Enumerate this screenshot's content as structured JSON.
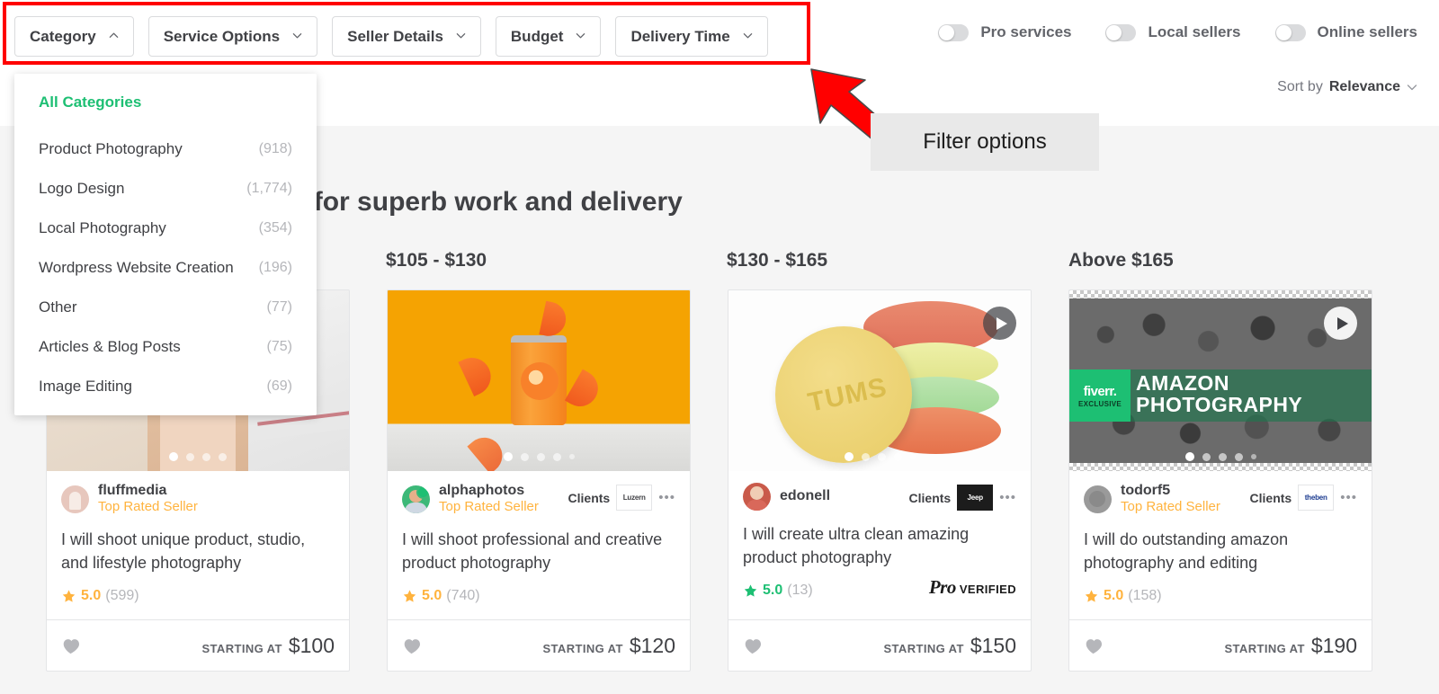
{
  "filter_bar": {
    "pills": [
      {
        "label": "Category",
        "icon": "chevron-up-icon",
        "expanded": true
      },
      {
        "label": "Service Options",
        "icon": "chevron-down-icon",
        "expanded": false
      },
      {
        "label": "Seller Details",
        "icon": "chevron-down-icon",
        "expanded": false
      },
      {
        "label": "Budget",
        "icon": "chevron-down-icon",
        "expanded": false
      },
      {
        "label": "Delivery Time",
        "icon": "chevron-down-icon",
        "expanded": false
      }
    ],
    "toggles": [
      {
        "label": "Pro services",
        "on": false
      },
      {
        "label": "Local sellers",
        "on": false
      },
      {
        "label": "Online sellers",
        "on": false
      }
    ],
    "sort": {
      "prefix": "Sort by",
      "value": "Relevance",
      "icon": "chevron-down-icon"
    }
  },
  "annotation": {
    "callout_label": "Filter options",
    "box_color": "#ff0000",
    "arrow_color": "#ff0000",
    "callout_bg": "#e9e9e9"
  },
  "category_dropdown": {
    "all_label": "All Categories",
    "items": [
      {
        "name": "Product Photography",
        "count": "(918)"
      },
      {
        "name": "Logo Design",
        "count": "(1,774)"
      },
      {
        "name": "Local Photography",
        "count": "(354)"
      },
      {
        "name": "Wordpress Website Creation",
        "count": "(196)"
      },
      {
        "name": "Other",
        "count": "(77)"
      },
      {
        "name": "Articles & Blog Posts",
        "count": "(75)"
      },
      {
        "name": "Image Editing",
        "count": "(69)"
      }
    ]
  },
  "headline": "es that people loved for superb work and delivery",
  "price_columns": [
    {
      "label": "$105 - $130"
    },
    {
      "label": "$130 - $165"
    },
    {
      "label": "Above $165"
    }
  ],
  "cards": [
    {
      "seller": "fluffmedia",
      "level": "Top Rated Seller",
      "title": "I will shoot unique product, studio, and lifestyle photography",
      "rating": "5.0",
      "reviews": "(599)",
      "starting_at": "STARTING AT",
      "price": "$100",
      "has_video": false,
      "clients": null,
      "pro_verified": false,
      "thumb": "collage-cosmetics",
      "dots": 4,
      "active_dot": 0
    },
    {
      "seller": "alphaphotos",
      "level": "Top Rated Seller",
      "title": "I will shoot professional and creative product photography",
      "rating": "5.0",
      "reviews": "(740)",
      "starting_at": "STARTING AT",
      "price": "$120",
      "has_video": false,
      "clients": {
        "label": "Clients",
        "logo": "Luzern",
        "menu": "•••"
      },
      "pro_verified": false,
      "thumb": "orange-soda-can",
      "dots": 5,
      "active_dot": 0
    },
    {
      "seller": "edonell",
      "level": "",
      "title": "I will create ultra clean amazing product photography",
      "rating": "5.0",
      "reviews": "(13)",
      "starting_at": "STARTING AT",
      "price": "$150",
      "has_video": true,
      "clients": {
        "label": "Clients",
        "logo": "Jeep",
        "menu": "•••"
      },
      "pro_verified": true,
      "pro_text": "Pro",
      "verified_text": "VERIFIED",
      "thumb": "tums-tablets",
      "dots": 5,
      "active_dot": 0
    },
    {
      "seller": "todorf5",
      "level": "Top Rated Seller",
      "title": "I will do outstanding amazon photography and editing",
      "rating": "5.0",
      "reviews": "(158)",
      "starting_at": "STARTING AT",
      "price": "$190",
      "has_video": true,
      "clients": {
        "label": "Clients",
        "logo": "theben",
        "menu": "•••"
      },
      "pro_verified": false,
      "thumb": "amazon-photography",
      "thumb_text": {
        "brand": "fiverr.",
        "brand_sub": "EXCLUSIVE",
        "line1": "AMAZON",
        "line2": "PHOTOGRAPHY"
      },
      "dots": 5,
      "active_dot": 0
    }
  ],
  "colors": {
    "brand_green": "#1dbf73",
    "star_orange": "#ffb33e",
    "text": "#404145",
    "muted": "#b5b6ba",
    "page_bg": "#f5f5f5"
  }
}
